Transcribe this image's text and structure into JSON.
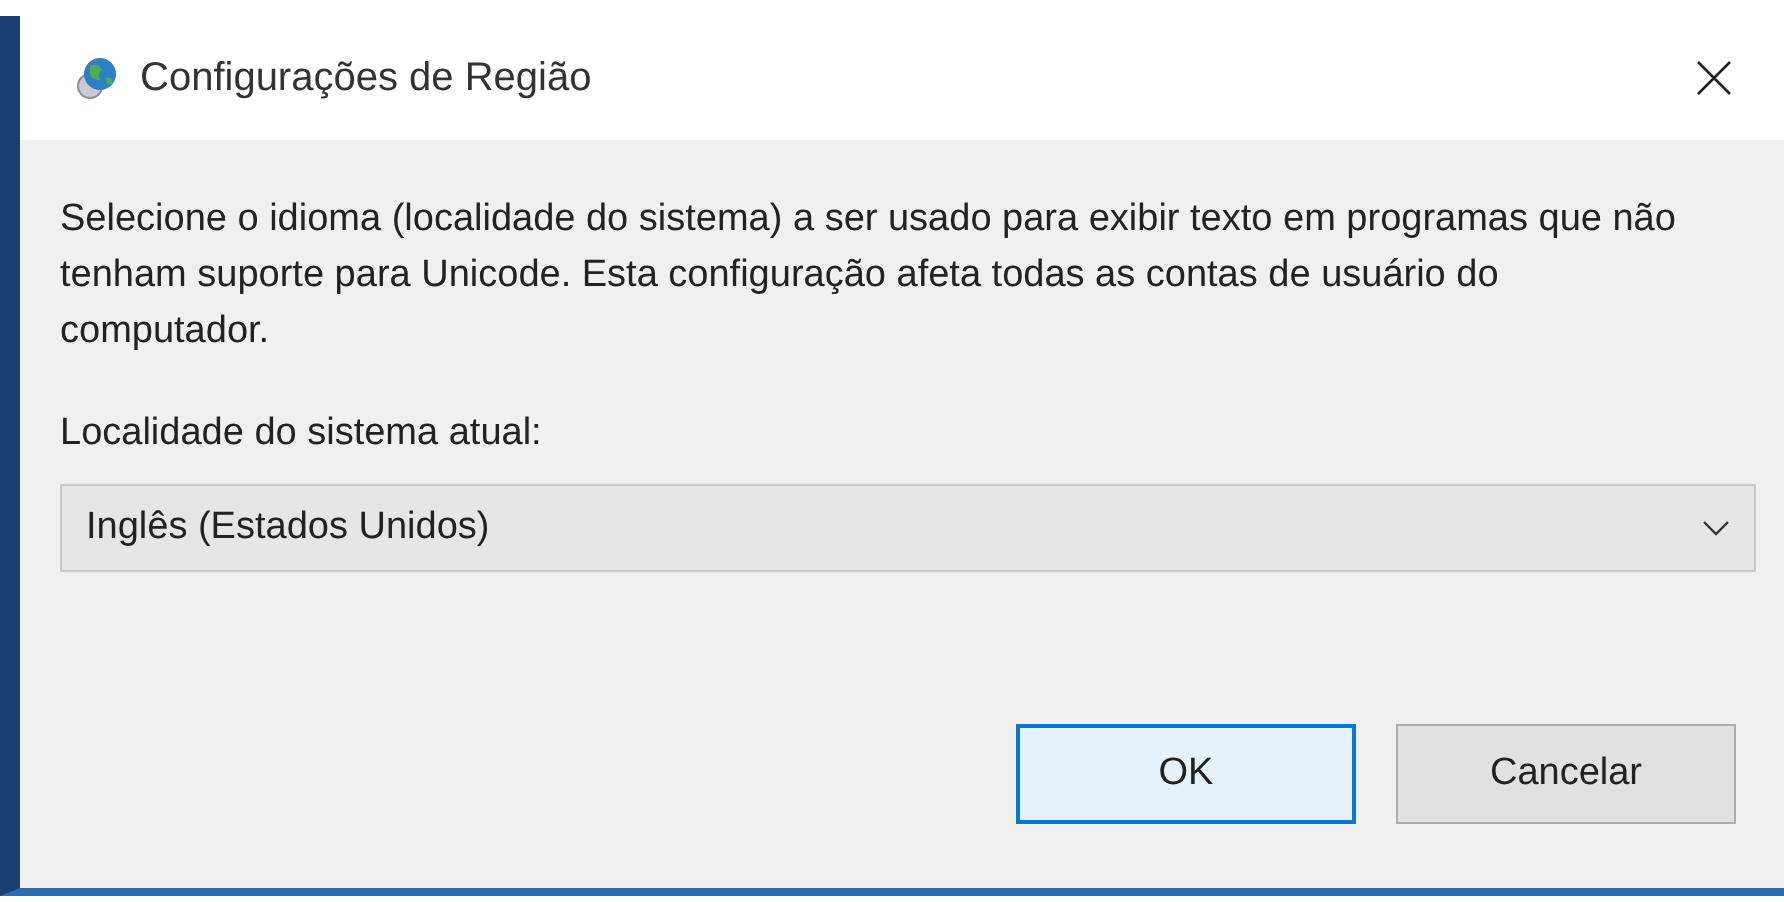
{
  "window": {
    "title": "Configurações de Região"
  },
  "description": "Selecione o idioma (localidade do sistema) a ser usado para exibir texto em programas que não tenham suporte para Unicode. Esta configuração afeta todas as contas de usuário do computador.",
  "locale": {
    "label": "Localidade do sistema atual:",
    "value": "Inglês (Estados Unidos)"
  },
  "buttons": [
    {
      "label": "OK",
      "default": true
    },
    {
      "label": "Cancelar",
      "default": false
    }
  ]
}
